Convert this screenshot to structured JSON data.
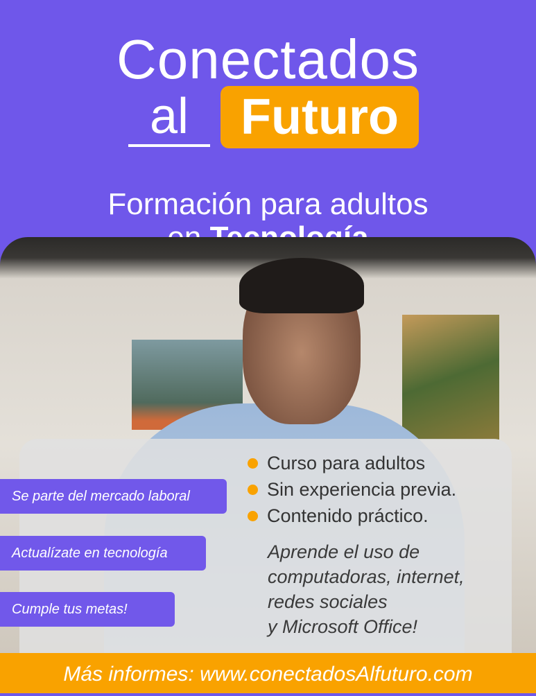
{
  "header": {
    "title_line1": "Conectados",
    "title_al": "al",
    "title_futuro": "Futuro",
    "subtitle_line1": "Formación para adultos",
    "subtitle_line2_prefix": "en ",
    "subtitle_line2_bold": "Tecnología"
  },
  "tags": [
    "Se parte del mercado laboral",
    "Actualízate en tecnología",
    "Cumple tus metas!"
  ],
  "bullets": [
    "Curso para adultos",
    "Sin experiencia previa.",
    "Contenido práctico."
  ],
  "description": [
    "Aprende el uso de",
    "computadoras, internet,",
    "redes sociales",
    "y Microsoft Office!"
  ],
  "footer": {
    "text": "Más informes: www.conectadosAlfuturo.com"
  },
  "colors": {
    "brand_purple": "#6f57ea",
    "accent_orange": "#f9a200"
  },
  "image": {
    "subject": "man-thinking-photo"
  }
}
